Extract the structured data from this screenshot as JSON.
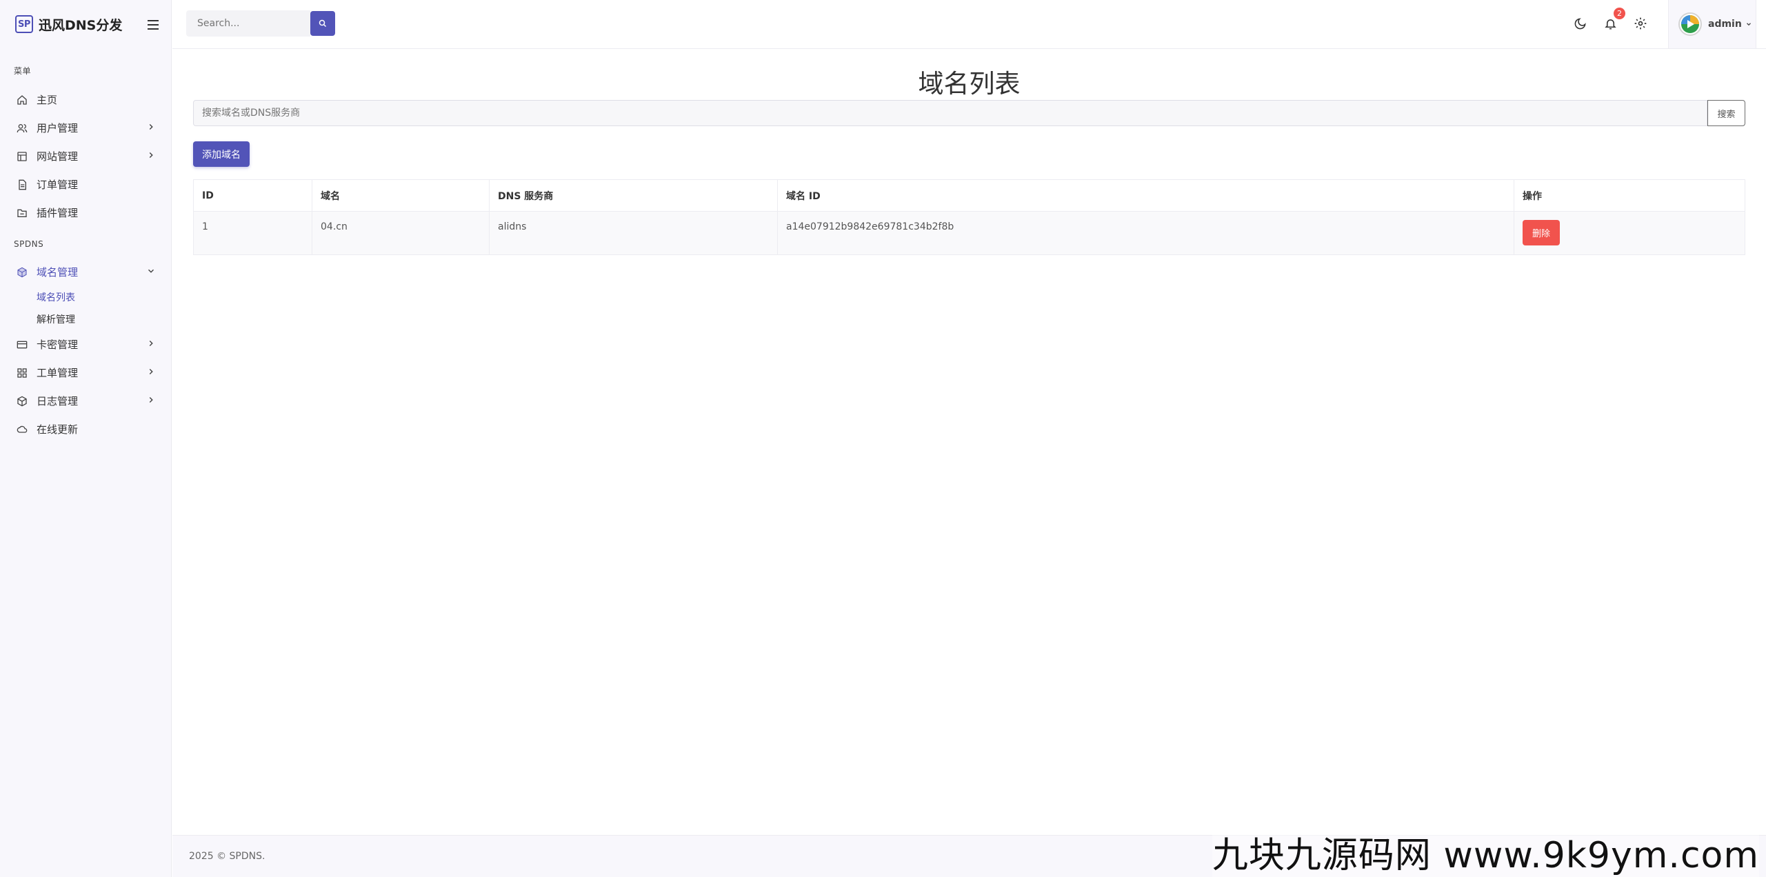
{
  "brand": {
    "logo": "SP",
    "name": "迅风DNS分发"
  },
  "header": {
    "search_placeholder": "Search...",
    "notification_count": "2",
    "user_name": "admin"
  },
  "sidebar": {
    "section_menu": "菜单",
    "section_spdns": "SPDNS",
    "items": [
      {
        "label": "主页",
        "icon": "home-icon"
      },
      {
        "label": "用户管理",
        "icon": "users-icon"
      },
      {
        "label": "网站管理",
        "icon": "layout-icon"
      },
      {
        "label": "订单管理",
        "icon": "file-icon"
      },
      {
        "label": "插件管理",
        "icon": "folder-icon"
      }
    ],
    "spdns_items": [
      {
        "label": "域名管理",
        "icon": "box-icon"
      },
      {
        "label": "卡密管理",
        "icon": "card-icon"
      },
      {
        "label": "工单管理",
        "icon": "grid-icon"
      },
      {
        "label": "日志管理",
        "icon": "cube-icon"
      },
      {
        "label": "在线更新",
        "icon": "cloud-icon"
      }
    ],
    "sub_items": [
      {
        "label": "域名列表"
      },
      {
        "label": "解析管理"
      }
    ]
  },
  "main": {
    "title": "域名列表",
    "search_placeholder": "搜索域名或DNS服务商",
    "search_button": "搜索",
    "add_button": "添加域名",
    "table": {
      "headers": [
        "ID",
        "域名",
        "DNS 服务商",
        "域名 ID",
        "操作"
      ],
      "rows": [
        {
          "id": "1",
          "domain": "04.cn",
          "provider": "alidns",
          "domain_id": "a14e07912b9842e69781c34b2f8b",
          "action": "删除"
        }
      ]
    }
  },
  "footer": {
    "copyright": "2025 © SPDNS."
  },
  "watermark": "九块九源码网 www.9k9ym.com",
  "colors": {
    "accent": "#5254b8",
    "danger": "#f1534d"
  }
}
